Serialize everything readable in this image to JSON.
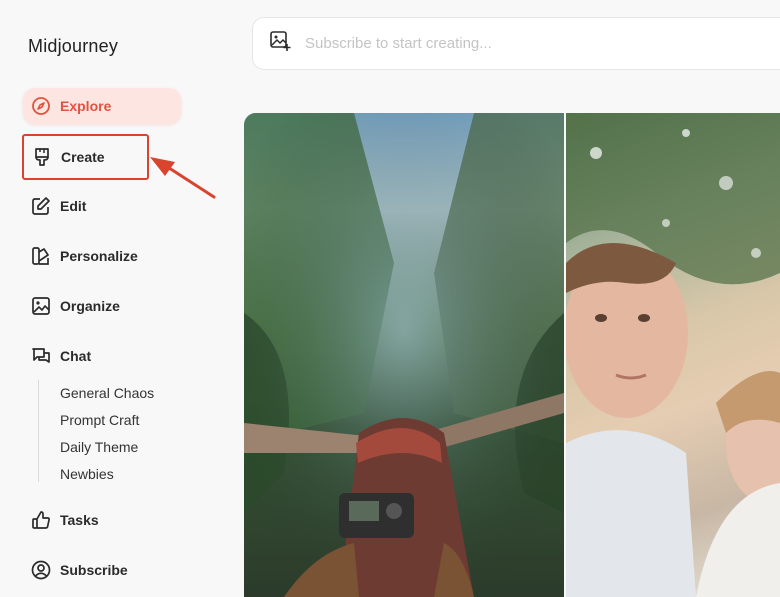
{
  "app": {
    "title": "Midjourney"
  },
  "nav": {
    "explore": "Explore",
    "create": "Create",
    "edit": "Edit",
    "personalize": "Personalize",
    "organize": "Organize",
    "chat": "Chat",
    "tasks": "Tasks",
    "subscribe": "Subscribe"
  },
  "chat_channels": [
    "General Chaos",
    "Prompt Craft",
    "Daily Theme",
    "Newbies"
  ],
  "search": {
    "placeholder": "Subscribe to start creating..."
  },
  "colors": {
    "accent": "#e0533f",
    "active_bg": "#fde6e2",
    "annotation": "#d9442e"
  }
}
